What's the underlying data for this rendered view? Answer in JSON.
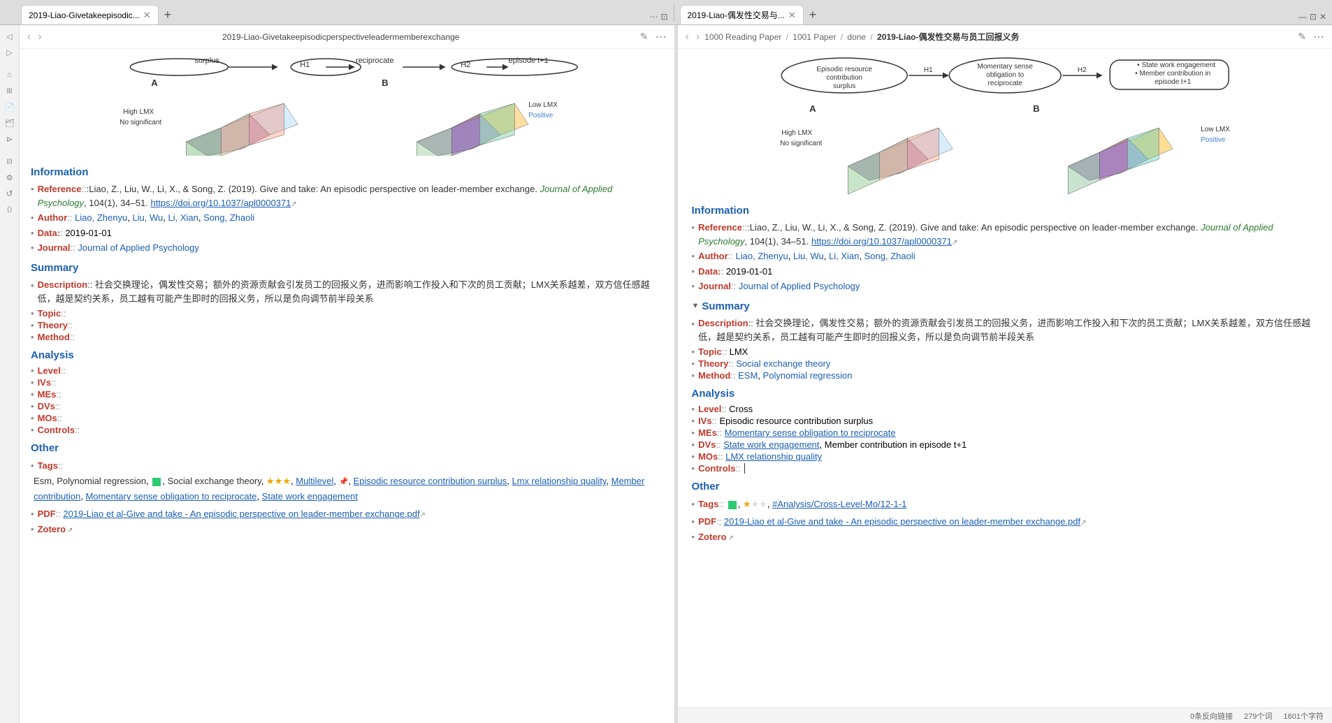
{
  "tabs_left": {
    "items": [
      {
        "id": "tab1",
        "title": "2019-Liao-Givetakeepisodic...",
        "active": true
      }
    ],
    "new_tab_label": "+"
  },
  "tabs_right": {
    "items": [
      {
        "id": "tab2",
        "title": "2019-Liao-偶发性交易与...",
        "active": true
      }
    ],
    "new_tab_label": "+"
  },
  "left_pane": {
    "title": "2019-Liao-Givetakeepisodicperspectiveleadermemberexchange",
    "breadcrumb": null,
    "sections": {
      "information": {
        "heading": "Information",
        "reference_label": "Reference",
        "reference_text": ":Liao, Z., Liu, W., Li, X., & Song, Z. (2019). Give and take: An episodic perspective on leader-member exchange.",
        "journal_italic": "Journal of Applied Psychology",
        "journal_vol": ", 104(1), 34–51.",
        "doi_link": "https://doi.org/10.1037/apl0000371",
        "author_label": "Author",
        "authors": [
          "Liao, Zhenyu",
          "Liu, Wu",
          "Li, Xian",
          "Song, Zhaoli"
        ],
        "data_label": "Data",
        "data_value": "2019-01-01",
        "journal_label": "Journal",
        "journal_value": "Journal of Applied Psychology"
      },
      "summary": {
        "heading": "Summary",
        "description_label": "Description",
        "description_text": ":: 社会交换理论，偶发性交易；额外的资源贡献会引发员工的回报义务，进而影响工作投入和下次的员工贡献；LMX关系越差，双方信任感越低，越是契约关系，员工越有可能产生即时的回报义务，所以是负向调节前半段关系",
        "topic_label": "Topic",
        "topic_value": "",
        "theory_label": "Theory",
        "theory_value": "",
        "method_label": "Method",
        "method_value": ""
      },
      "analysis": {
        "heading": "Analysis",
        "level_label": "Level",
        "level_value": "",
        "ivs_label": "IVs",
        "ivs_value": "",
        "mes_label": "MEs",
        "mes_value": "",
        "dvs_label": "DVs",
        "dvs_value": "",
        "mos_label": "MOs",
        "mos_value": "",
        "controls_label": "Controls",
        "controls_value": ""
      },
      "other": {
        "heading": "Other",
        "tags_label": "Tags",
        "tags": [
          "Esm",
          "Polynomial regression",
          "Social exchange theory",
          "Multilevel",
          "Episodic resource contribution surplus",
          "Lmx relationship quality",
          "Member contribution",
          "Momentary sense obligation to reciprocate",
          "State work engagement"
        ],
        "pdf_label": "PDF",
        "pdf_link": "2019-Liao et al-Give and take - An episodic perspective on leader-member exchange.pdf",
        "zotero_label": "Zotero"
      }
    }
  },
  "right_pane": {
    "title": "1000 Reading Paper / 1001 Paper / done / 2019-Liao-偶发性交易与员工回报义务",
    "breadcrumb": {
      "parts": [
        "1000 Reading Paper",
        "1001 Paper",
        "done"
      ],
      "current": "2019-Liao-偶发性交易与员工回报义务"
    },
    "sections": {
      "information": {
        "heading": "Information",
        "reference_label": "Reference",
        "reference_text": ":Liao, Z., Liu, W., Li, X., & Song, Z. (2019). Give and take: An episodic perspective on leader-member exchange.",
        "journal_italic": "Journal of Applied Psychology",
        "journal_vol": ", 104(1), 34–51.",
        "doi_link": "https://doi.org/10.1037/apl0000371",
        "author_label": "Author",
        "authors": [
          "Liao, Zhenyu",
          "Liu, Wu",
          "Li, Xian",
          "Song, Zhaoli"
        ],
        "data_label": "Data",
        "data_value": "2019-01-01",
        "journal_label": "Journal",
        "journal_value": "Journal of Applied Psychology"
      },
      "summary": {
        "heading": "Summary",
        "collapsed": false,
        "description_label": "Description",
        "description_text": ":: 社会交换理论，偶发性交易；额外的资源贡献会引发员工的回报义务，进而影响工作投入和下次的员工贡献；LMX关系越差，双方信任感越低，越是契约关系，员工越有可能产生即时的回报义务，所以是负向调节前半段关系",
        "topic_label": "Topic",
        "topic_value": "LMX",
        "theory_label": "Theory",
        "theory_value": "Social exchange theory",
        "method_label": "Method",
        "method_value": "ESM, Polynomial regression"
      },
      "analysis": {
        "heading": "Analysis",
        "level_label": "Level",
        "level_value": "Cross",
        "ivs_label": "IVs",
        "ivs_value": "Episodic resource contribution surplus",
        "mes_label": "MEs",
        "mes_value": "Momentary sense obligation to reciprocate",
        "dvs_label": "DVs",
        "dvs_value": "State work engagement, Member contribution in episode t+1",
        "mos_label": "MOs",
        "mos_value": "LMX relationship quality",
        "controls_label": "Controls",
        "controls_value": "/"
      },
      "other": {
        "heading": "Other",
        "tags_label": "Tags",
        "tags_special": "#Analysis/Cross-Level-Mo/12-1-1",
        "pdf_label": "PDF",
        "pdf_link": "2019-Liao et al-Give and take - An episodic perspective on leader-member exchange.pdf",
        "zotero_label": "Zotero"
      }
    }
  },
  "status_bar": {
    "text1": "0条反向链接",
    "text2": "279个词",
    "text3": "1601个字符"
  },
  "icons": {
    "back": "‹",
    "forward": "›",
    "edit": "✎",
    "more": "⋯",
    "collapse": "▼",
    "expand": "▶",
    "external": "↗",
    "bullet": "•",
    "bullet_sm": "·"
  }
}
